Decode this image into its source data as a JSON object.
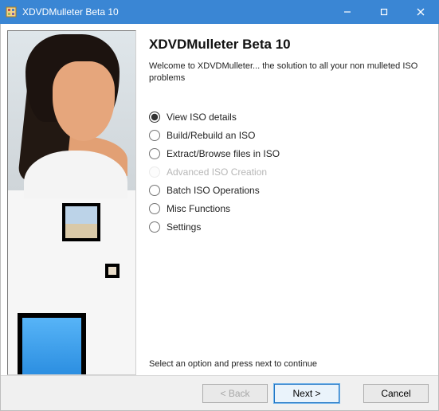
{
  "window": {
    "title": "XDVDMulleter Beta 10"
  },
  "heading": "XDVDMulleter Beta 10",
  "welcome": "Welcome to XDVDMulleter... the solution to all your non mulleted ISO problems",
  "options": [
    {
      "label": "View ISO details",
      "selected": true,
      "enabled": true
    },
    {
      "label": "Build/Rebuild an ISO",
      "selected": false,
      "enabled": true
    },
    {
      "label": "Extract/Browse files in ISO",
      "selected": false,
      "enabled": true
    },
    {
      "label": "Advanced ISO Creation",
      "selected": false,
      "enabled": false
    },
    {
      "label": "Batch ISO Operations",
      "selected": false,
      "enabled": true
    },
    {
      "label": "Misc Functions",
      "selected": false,
      "enabled": true
    },
    {
      "label": "Settings",
      "selected": false,
      "enabled": true
    }
  ],
  "instruction": "Select an option and press next to continue",
  "buttons": {
    "back": "< Back",
    "next": "Next >",
    "cancel": "Cancel"
  }
}
